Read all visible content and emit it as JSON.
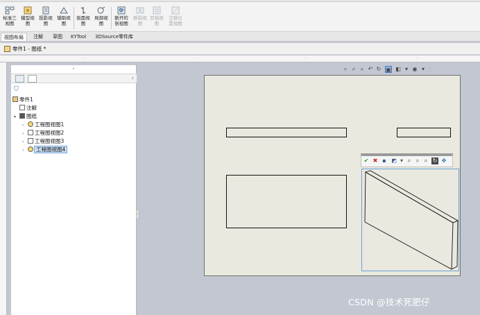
{
  "ribbon": {
    "buttons": [
      {
        "label1": "标准三",
        "label2": "视图"
      },
      {
        "label1": "模型视",
        "label2": "图"
      },
      {
        "label1": "投影视",
        "label2": "图"
      },
      {
        "label1": "辅助视",
        "label2": "图"
      },
      {
        "label1": "剖面视",
        "label2": "图"
      },
      {
        "label1": "局部视",
        "label2": "图"
      },
      {
        "label1": "断开的",
        "label2": "剖视图"
      },
      {
        "label1": "断裂视",
        "label2": "图"
      },
      {
        "label1": "剪裁视",
        "label2": "图"
      },
      {
        "label1": "交替位",
        "label2": "置视图"
      }
    ]
  },
  "command_tabs": [
    "视图布局",
    "注解",
    "草图",
    "KYTool",
    "3DSource零件库"
  ],
  "document": {
    "title": "零件1 - 图纸 *"
  },
  "tree": {
    "root": "零件1",
    "annotations": "注解",
    "sheet": "图纸",
    "views": [
      "工程图视图1",
      "工程图视图2",
      "工程图视图3",
      "工程图视图4"
    ]
  },
  "watermark": "CSDN @技术死肥仔",
  "colors": {
    "selection": "#c9def5",
    "viewport": "#c2c7d1",
    "sheet": "#e9e9df",
    "accept": "#1f9a1f",
    "cancel": "#d22222"
  }
}
